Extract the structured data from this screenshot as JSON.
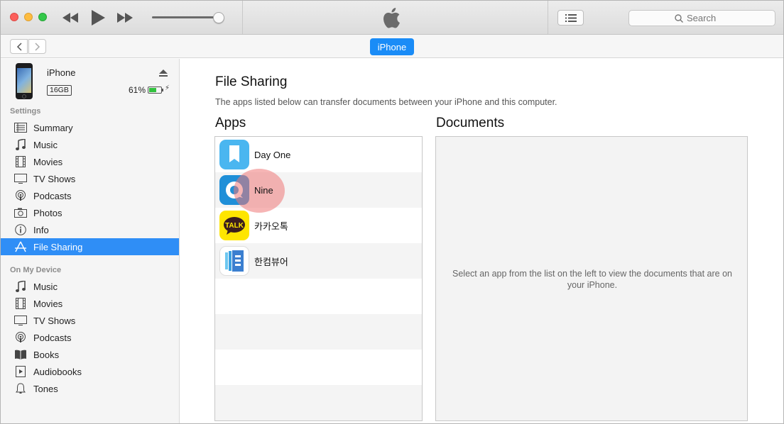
{
  "toolbar": {
    "search_placeholder": "Search"
  },
  "navbar": {
    "device_label": "iPhone"
  },
  "device": {
    "name": "iPhone",
    "capacity": "16GB",
    "battery_percent": "61%",
    "battery_level": 0.61
  },
  "sidebar": {
    "settings_heading": "Settings",
    "settings_items": [
      {
        "label": "Summary",
        "icon": "summary-icon"
      },
      {
        "label": "Music",
        "icon": "music-note-icon"
      },
      {
        "label": "Movies",
        "icon": "film-icon"
      },
      {
        "label": "TV Shows",
        "icon": "tv-icon"
      },
      {
        "label": "Podcasts",
        "icon": "podcast-icon"
      },
      {
        "label": "Photos",
        "icon": "camera-icon"
      },
      {
        "label": "Info",
        "icon": "info-icon"
      },
      {
        "label": "File Sharing",
        "icon": "app-store-icon",
        "selected": true
      }
    ],
    "device_heading": "On My Device",
    "device_items": [
      {
        "label": "Music",
        "icon": "music-note-icon"
      },
      {
        "label": "Movies",
        "icon": "film-icon"
      },
      {
        "label": "TV Shows",
        "icon": "tv-icon"
      },
      {
        "label": "Podcasts",
        "icon": "podcast-icon"
      },
      {
        "label": "Books",
        "icon": "book-icon"
      },
      {
        "label": "Audiobooks",
        "icon": "audiobook-icon"
      },
      {
        "label": "Tones",
        "icon": "bell-icon"
      }
    ]
  },
  "main": {
    "title": "File Sharing",
    "description": "The apps listed below can transfer documents between your iPhone and this computer.",
    "apps_heading": "Apps",
    "documents_heading": "Documents",
    "apps": [
      {
        "name": "Day One",
        "icon": "day-one-icon"
      },
      {
        "name": "Nine",
        "icon": "nine-icon"
      },
      {
        "name": "카카오톡",
        "icon": "kakaotalk-icon",
        "icon_text": "TALK"
      },
      {
        "name": "한컴뷰어",
        "icon": "hancom-viewer-icon"
      }
    ],
    "documents_message": "Select an app from the list on the left to view the documents that are on your iPhone."
  },
  "colors": {
    "accent": "#2f8ef6",
    "pill": "#1a8cf7",
    "day_one": "#4ab6f0",
    "nine": "#1f8fd8",
    "kakaotalk": "#fee500",
    "click_marker": "#ef7878"
  }
}
